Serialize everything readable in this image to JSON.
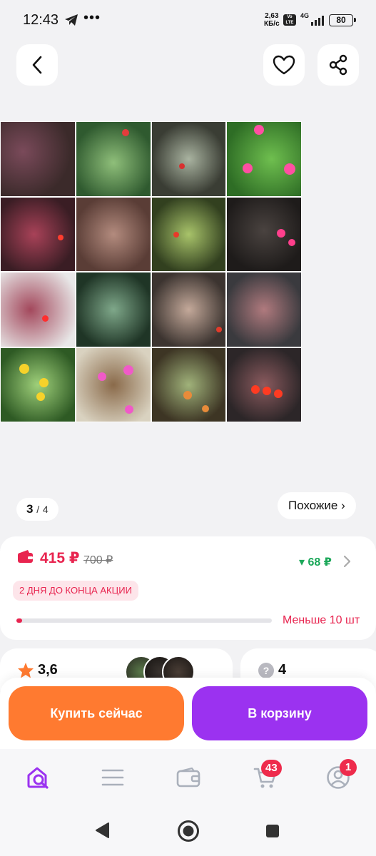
{
  "status_bar": {
    "time": "12:43",
    "telegram_icon": "telegram-icon",
    "more_dots": "•••",
    "net_speed_value": "2,63",
    "net_speed_unit": "КБ/с",
    "volte": "Vo LTE",
    "network_type": "4G",
    "battery": "80"
  },
  "header": {
    "back_icon": "chevron-left-icon",
    "favorite_icon": "heart-icon",
    "share_icon": "share-icon"
  },
  "gallery": {
    "current": "3",
    "separator": "/",
    "total": "4",
    "similar_label": "Похожие ›"
  },
  "price": {
    "current": "415 ₽",
    "old": "700 ₽",
    "cashback": "▾ 68 ₽",
    "promo": "2 ДНЯ ДО КОНЦА АКЦИИ",
    "stock_text": "Меньше 10 шт",
    "stock_fraction": 0.02
  },
  "reviews": {
    "rating": "3,6",
    "questions": "4"
  },
  "actions": {
    "buy_now": "Купить сейчас",
    "add_to_cart": "В корзину"
  },
  "tab_bar": {
    "cart_badge": "43",
    "profile_badge": "1"
  },
  "colors": {
    "accent_red": "#e8244f",
    "accent_green": "#1ca85a",
    "buy_orange": "#ff7a30",
    "cart_purple": "#9b32f0"
  }
}
